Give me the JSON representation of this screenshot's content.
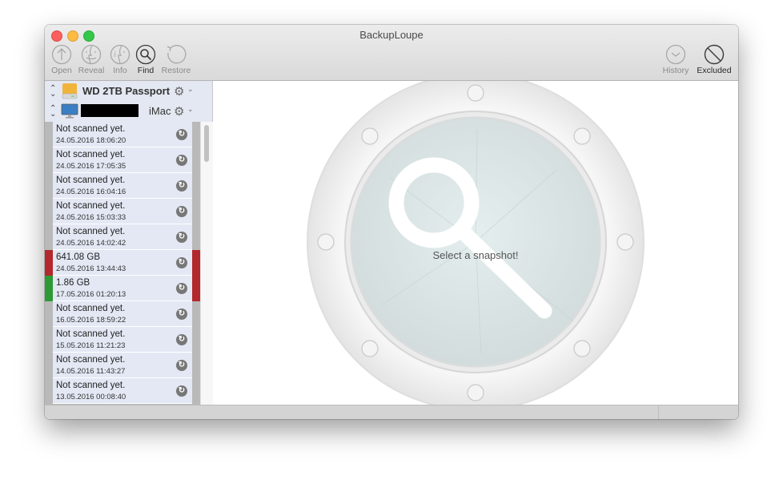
{
  "window": {
    "title": "BackupLoupe"
  },
  "toolbar": {
    "left": [
      {
        "id": "open",
        "label": "Open",
        "icon": "arrow-up-circle-icon",
        "enabled": false
      },
      {
        "id": "reveal",
        "label": "Reveal",
        "icon": "finder-icon",
        "enabled": false
      },
      {
        "id": "info",
        "label": "Info",
        "icon": "info-finder-icon",
        "enabled": false
      },
      {
        "id": "find",
        "label": "Find",
        "icon": "magnifier-circle-icon",
        "enabled": true
      },
      {
        "id": "restore",
        "label": "Restore",
        "icon": "restore-arrow-icon",
        "enabled": false
      }
    ],
    "right": [
      {
        "id": "history",
        "label": "History",
        "icon": "clock-icon",
        "enabled": false
      },
      {
        "id": "excluded",
        "label": "Excluded",
        "icon": "prohibited-icon",
        "enabled": true
      }
    ]
  },
  "sources": {
    "disk": {
      "name": "WD 2TB Passport",
      "icon": "external-drive-icon"
    },
    "machine": {
      "name": "iMac",
      "name_redacted": true,
      "icon": "imac-icon"
    }
  },
  "snapshots": [
    {
      "title": "Not scanned yet.",
      "date": "24.05.2016 18:06:20",
      "left_status": "none",
      "right_status": "none"
    },
    {
      "title": "Not scanned yet.",
      "date": "24.05.2016 17:05:35",
      "left_status": "none",
      "right_status": "none"
    },
    {
      "title": "Not scanned yet.",
      "date": "24.05.2016 16:04:16",
      "left_status": "none",
      "right_status": "none"
    },
    {
      "title": "Not scanned yet.",
      "date": "24.05.2016 15:03:33",
      "left_status": "none",
      "right_status": "none"
    },
    {
      "title": "Not scanned yet.",
      "date": "24.05.2016 14:02:42",
      "left_status": "none",
      "right_status": "none"
    },
    {
      "title": "641.08 GB",
      "date": "24.05.2016 13:44:43",
      "left_status": "red",
      "right_status": "red"
    },
    {
      "title": "1.86 GB",
      "date": "17.05.2016 01:20:13",
      "left_status": "green",
      "right_status": "red"
    },
    {
      "title": "Not scanned yet.",
      "date": "16.05.2016 18:59:22",
      "left_status": "none",
      "right_status": "none"
    },
    {
      "title": "Not scanned yet.",
      "date": "15.05.2016 11:21:23",
      "left_status": "none",
      "right_status": "none"
    },
    {
      "title": "Not scanned yet.",
      "date": "14.05.2016 11:43:27",
      "left_status": "none",
      "right_status": "none"
    },
    {
      "title": "Not scanned yet.",
      "date": "13.05.2016 00:08:40",
      "left_status": "none",
      "right_status": "none"
    }
  ],
  "colors": {
    "red": "#b3282d",
    "green": "#2e9a35",
    "none": "#b9b9b9"
  },
  "main": {
    "placeholder_text": "Select a snapshot!"
  }
}
